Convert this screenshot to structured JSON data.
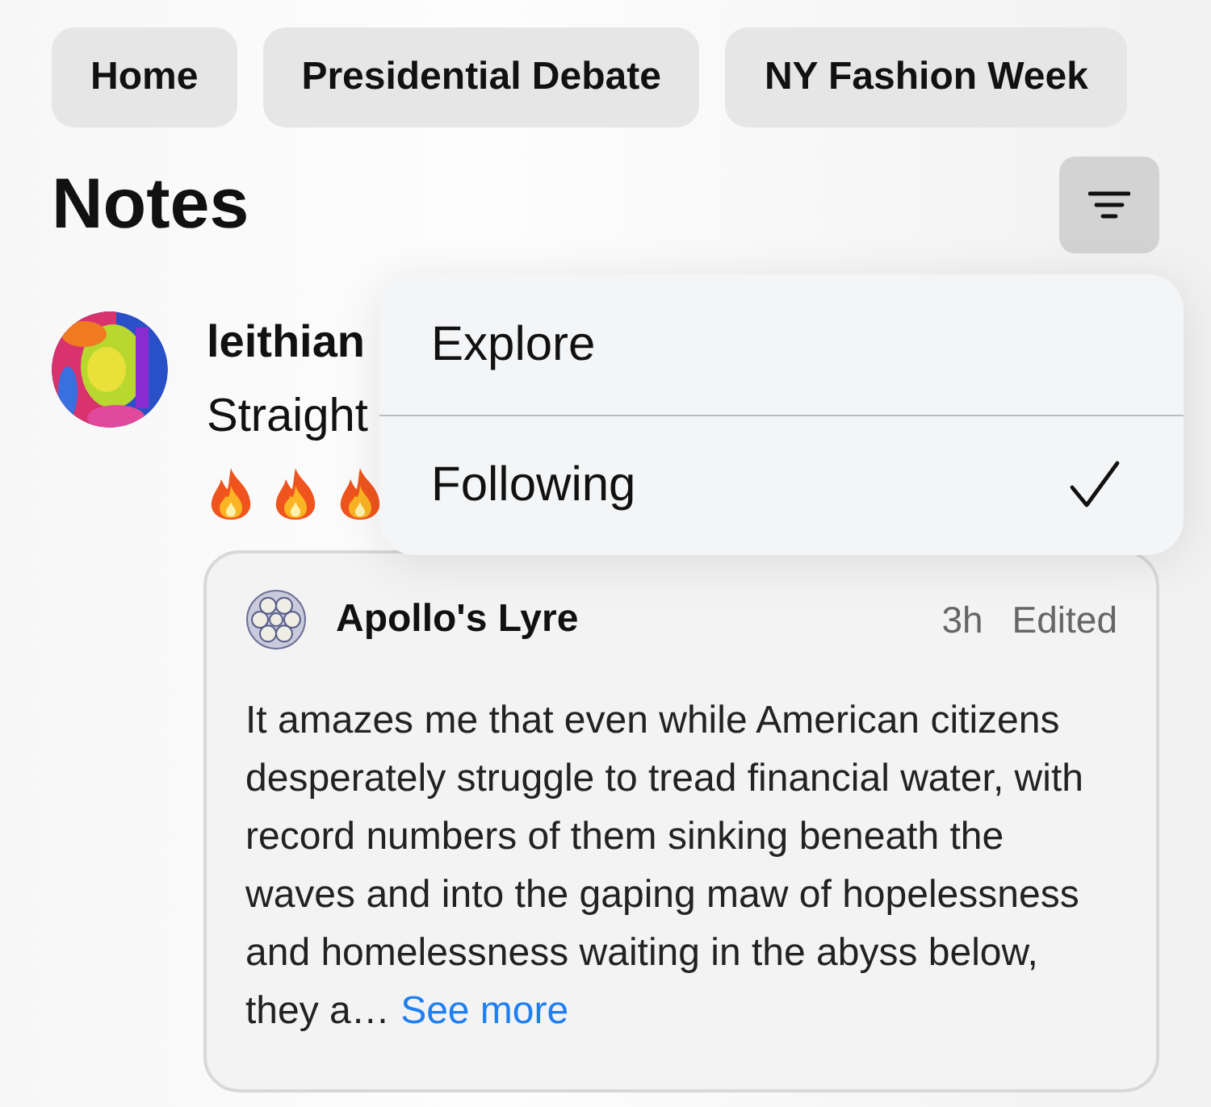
{
  "tabs": [
    {
      "label": "Home"
    },
    {
      "label": "Presidential Debate"
    },
    {
      "label": "NY Fashion Week"
    }
  ],
  "title": "Notes",
  "filter_menu": {
    "items": [
      {
        "label": "Explore",
        "selected": false
      },
      {
        "label": "Following",
        "selected": true
      }
    ]
  },
  "note": {
    "author": "leithian",
    "text": "Straight",
    "reactions": [
      {
        "kind": "fire"
      },
      {
        "kind": "fire"
      },
      {
        "kind": "fire"
      }
    ],
    "quote": {
      "author": "Apollo's Lyre",
      "time": "3h",
      "edited": "Edited",
      "body": "It amazes me that even while American citizens desperately struggle to tread financial water, with record numbers of them sinking beneath the waves and into the gaping maw of hopelessness and homelessness waiting in the abyss below, they a…",
      "more": "See more"
    }
  }
}
